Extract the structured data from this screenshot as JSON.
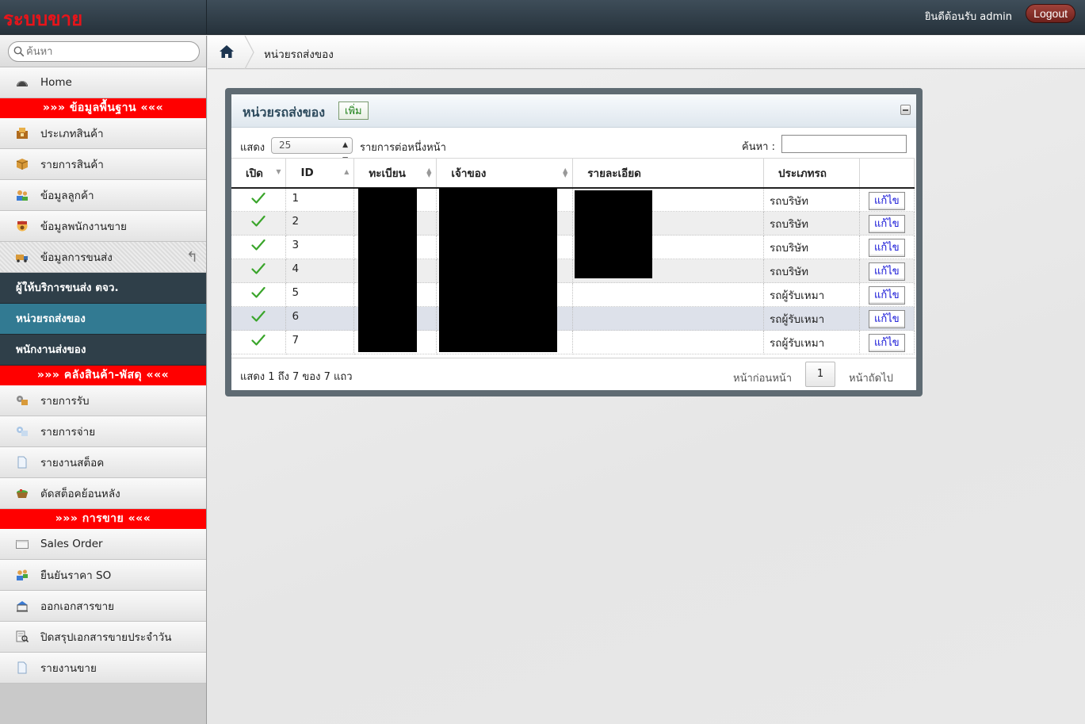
{
  "app": {
    "brand": "ระบบขาย",
    "welcome": "ยินดีต้อนรับ admin",
    "logout": "Logout"
  },
  "sidebar": {
    "search_placeholder": "ค้นหา",
    "home": "Home",
    "section_master": "»»» ข้อมูลพื้นฐาน «««",
    "master_items": [
      "ประเภทสินค้า",
      "รายการสินค้า",
      "ข้อมูลลูกค้า",
      "ข้อมูลพนักงานขาย",
      "ข้อมูลการขนส่ง"
    ],
    "transport_sub": [
      "ผู้ให้บริการขนส่ง ตจว.",
      "หน่วยรถส่งของ",
      "พนักงานส่งของ"
    ],
    "section_stock": "»»» คลังสินค้า-พัสดุ «««",
    "stock_items": [
      "รายการรับ",
      "รายการจ่าย",
      "รายงานสต็อค",
      "ตัดสต็อคย้อนหลัง"
    ],
    "section_sales": "»»» การขาย «««",
    "sales_items": [
      "Sales Order",
      "ยืนยันราคา SO",
      "ออกเอกสารขาย",
      "ปิดสรุปเอกสารขายประจำวัน",
      "รายงานขาย"
    ]
  },
  "breadcrumb": {
    "current": "หน่วยรถส่งของ"
  },
  "panel": {
    "title": "หน่วยรถส่งของ",
    "add": "เพิ่ม",
    "show_label": "แสดง",
    "page_size": "25",
    "per_page_label": "รายการต่อหนึ่งหน้า",
    "filter_label": "ค้นหา :",
    "columns": [
      "เปิด",
      "ID",
      "ทะเบียน",
      "เจ้าของ",
      "รายละเอียด",
      "ประเภทรถ",
      ""
    ],
    "rows": [
      {
        "id": "1",
        "type": "รถบริษัท",
        "edit": "แก้ไข"
      },
      {
        "id": "2",
        "type": "รถบริษัท",
        "edit": "แก้ไข"
      },
      {
        "id": "3",
        "type": "รถบริษัท",
        "edit": "แก้ไข"
      },
      {
        "id": "4",
        "type": "รถบริษัท",
        "edit": "แก้ไข"
      },
      {
        "id": "5",
        "type": "รถผู้รับเหมา",
        "edit": "แก้ไข"
      },
      {
        "id": "6",
        "type": "รถผู้รับเหมา",
        "edit": "แก้ไข"
      },
      {
        "id": "7",
        "type": "รถผู้รับเหมา",
        "edit": "แก้ไข"
      }
    ],
    "info": "แสดง 1 ถึง 7 ของ 7 แถว",
    "prev": "หน้าก่อนหน้า",
    "page": "1",
    "next": "หน้าถัดไป"
  },
  "colors": {
    "brand_red": "#e8141a",
    "section_red": "#ff0000",
    "sidebar_dark": "#2f3f49",
    "sidebar_active": "#327a92",
    "check_green": "#3aa52b"
  }
}
